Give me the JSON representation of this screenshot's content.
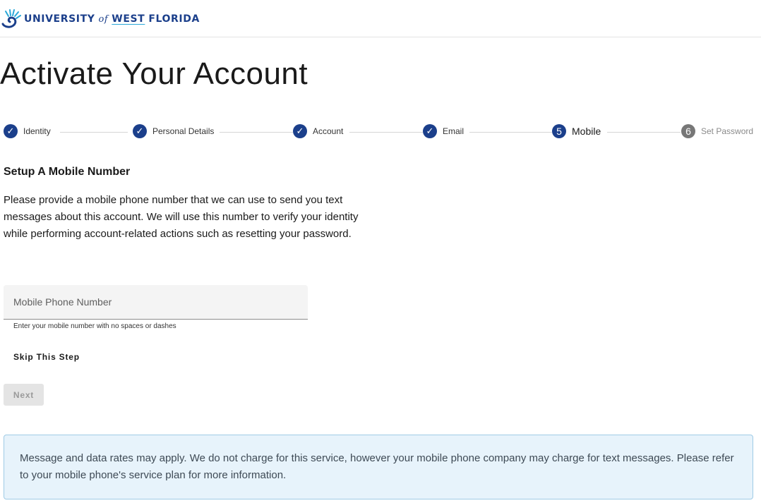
{
  "header": {
    "logo": {
      "part1": "UNIVERSITY",
      "part2": "of",
      "part3": "WEST",
      "part4": "FLORIDA"
    }
  },
  "title": "Activate Your Account",
  "stepper": {
    "steps": [
      {
        "label": "Identity",
        "state": "done"
      },
      {
        "label": "Personal Details",
        "state": "done"
      },
      {
        "label": "Account",
        "state": "done"
      },
      {
        "label": "Email",
        "state": "done"
      },
      {
        "label": "Mobile",
        "number": "5",
        "state": "active"
      },
      {
        "label": "Set Password",
        "number": "6",
        "state": "todo"
      }
    ]
  },
  "section": {
    "title": "Setup A Mobile Number",
    "description": "Please provide a mobile phone number that we can use to send you text messages about this account. We will use this number to verify your identity while performing account-related actions such as resetting your password."
  },
  "mobile_field": {
    "placeholder": "Mobile Phone Number",
    "value": "",
    "hint": "Enter your mobile number with no spaces or dashes"
  },
  "buttons": {
    "skip": "Skip This Step",
    "next": "Next"
  },
  "info": {
    "text": "Message and data rates may apply. We do not charge for this service, however your mobile phone company may charge for text messages. Please refer to your mobile phone's service plan for more information."
  },
  "colors": {
    "brand": "#1b3f8b",
    "info_bg": "#e7f3fb",
    "info_border": "#9fcbe6"
  }
}
